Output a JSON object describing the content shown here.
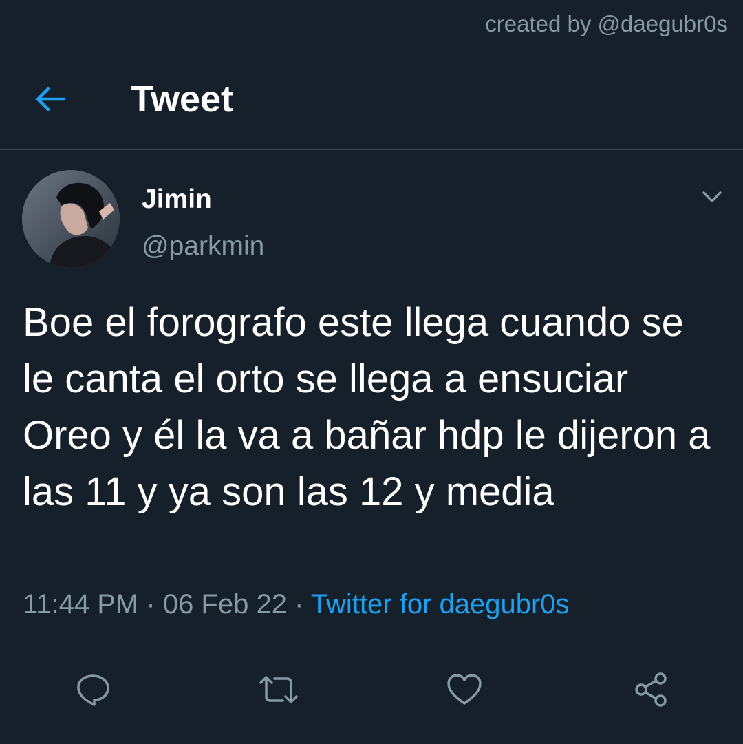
{
  "credit": "created by @daegubr0s",
  "header": {
    "title": "Tweet",
    "back_icon": "arrow-left-icon"
  },
  "tweet": {
    "display_name": "Jimin",
    "handle": "@parkmin",
    "text": "Boe el forografo este llega cuando se le canta el orto se llega a ensuciar Oreo y él la va a bañar hdp le dijeron a las 11 y ya son las 12 y media",
    "time": "11:44 PM",
    "date": "06 Feb 22",
    "separator": "·",
    "source": "Twitter for daegubr0s"
  },
  "actions": [
    "reply-icon",
    "retweet-icon",
    "like-icon",
    "share-icon"
  ],
  "colors": {
    "background": "#15202b",
    "accent": "#1da1f2",
    "secondary_text": "#8899a6",
    "border": "#38444d"
  }
}
